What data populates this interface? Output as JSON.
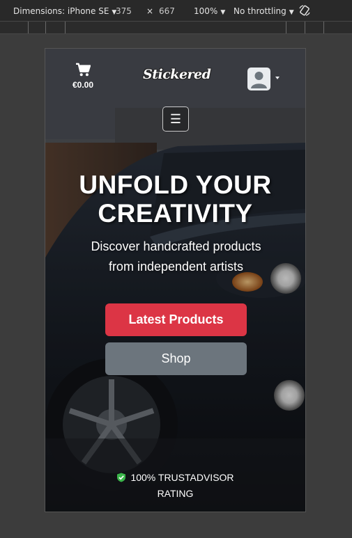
{
  "devtools": {
    "device_label": "Dimensions: iPhone SE",
    "width": "375",
    "times": "×",
    "height": "667",
    "zoom": "100%",
    "throttling": "No throttling",
    "icons": [
      "dropdown-caret",
      "rotate-icon"
    ]
  },
  "site": {
    "cart_amount": "€0.00",
    "logo_text": "Stickered",
    "menu_icon": "☰",
    "headline_line1": "UNFOLD YOUR",
    "headline_line2": "CREATIVITY",
    "subhead_line1": "Discover handcrafted products",
    "subhead_line2": "from independent artists",
    "primary_button": "Latest Products",
    "secondary_button": "Shop",
    "trust_line1": "100% TRUSTADVISOR",
    "trust_line2": "RATING",
    "colors": {
      "primary": "#dc3545",
      "secondary": "#6c757d",
      "trust_check": "#3bb54a"
    }
  }
}
